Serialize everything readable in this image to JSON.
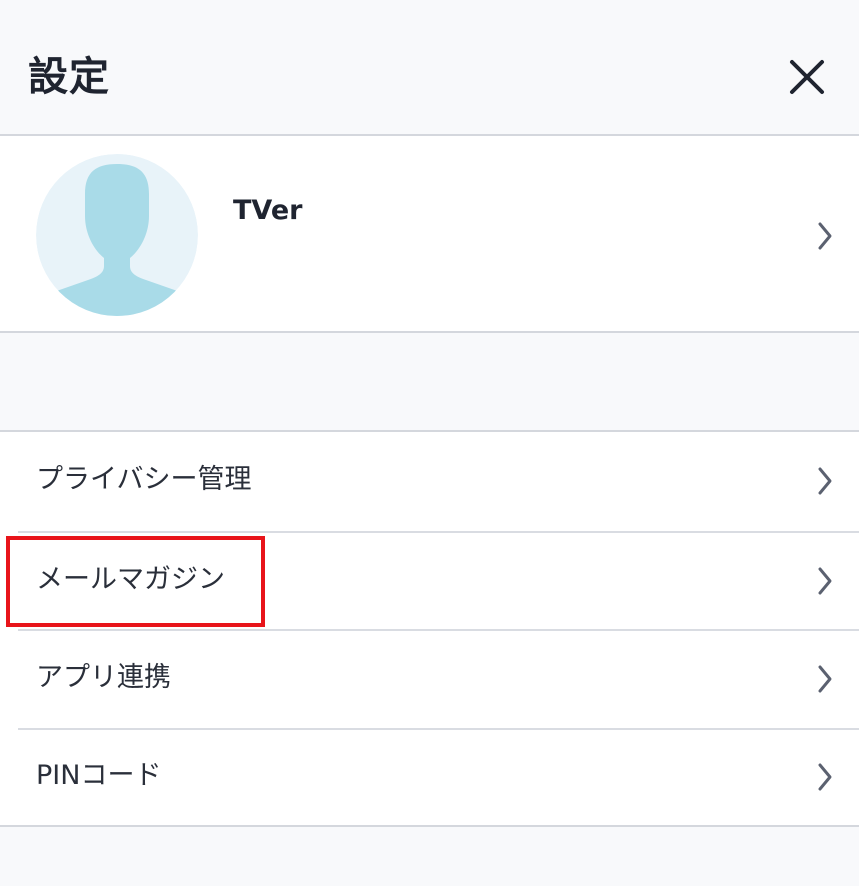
{
  "header": {
    "title": "設定",
    "close_icon": "close-icon"
  },
  "profile": {
    "name": "TVer",
    "avatar_icon": "avatar-placeholder-icon",
    "chevron_icon": "chevron-right-icon"
  },
  "menu": {
    "items": [
      {
        "label": "プライバシー管理",
        "icon": "chevron-right-icon"
      },
      {
        "label": "メールマガジン",
        "icon": "chevron-right-icon",
        "highlighted": true
      },
      {
        "label": "アプリ連携",
        "icon": "chevron-right-icon"
      },
      {
        "label": "PINコード",
        "icon": "chevron-right-icon"
      }
    ]
  },
  "colors": {
    "background": "#f8f9fb",
    "surface": "#ffffff",
    "divider": "#d4d7dd",
    "text": "#1f2430",
    "chevron": "#5b6170",
    "avatar_bg": "#e8f3f9",
    "avatar_silhouette": "#a9dbe8",
    "highlight": "#e8141a"
  }
}
